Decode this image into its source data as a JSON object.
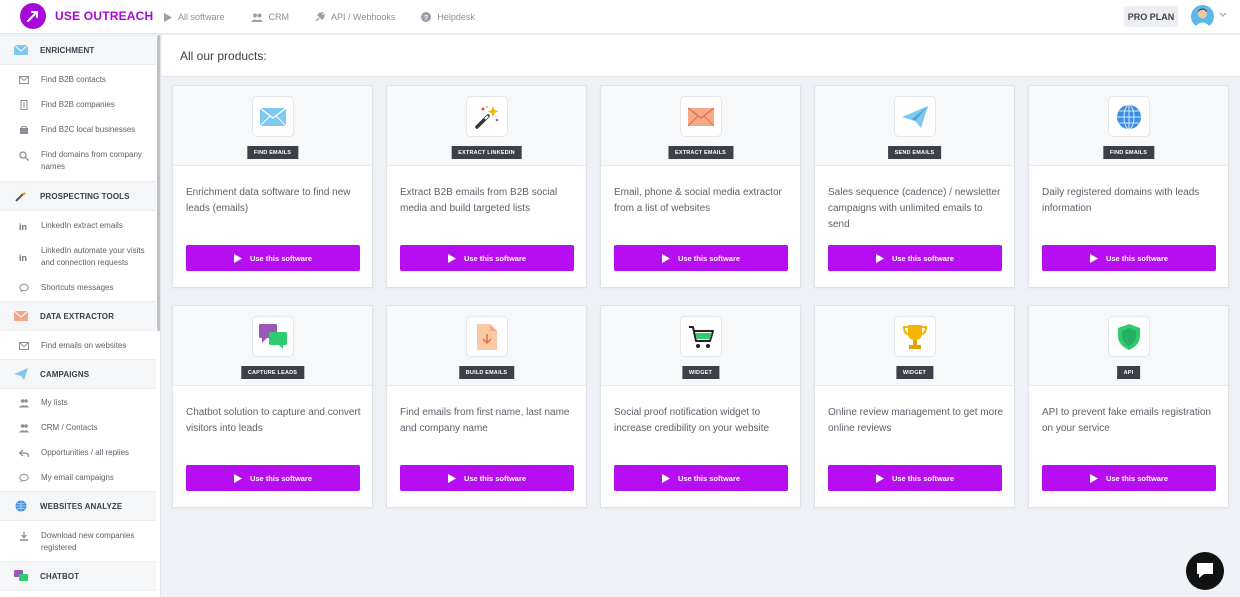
{
  "brand": {
    "name": "USE OUTREACH",
    "color": "#a707d8"
  },
  "nav": [
    {
      "label": "All software",
      "icon": "play-icon"
    },
    {
      "label": "CRM",
      "icon": "users-icon"
    },
    {
      "label": "API / Webhooks",
      "icon": "plug-icon"
    },
    {
      "label": "Helpdesk",
      "icon": "help-icon"
    }
  ],
  "plan": "PRO PLAN",
  "sidebar": {
    "sections": [
      {
        "label": "ENRICHMENT",
        "icon": "envelope-icon",
        "items": [
          {
            "label": "Find B2B contacts",
            "icon": "envelope-icon"
          },
          {
            "label": "Find B2B companies",
            "icon": "building-icon"
          },
          {
            "label": "Find B2C local businesses",
            "icon": "shop-icon"
          },
          {
            "label": "Find domains from company names",
            "icon": "search-icon"
          }
        ]
      },
      {
        "label": "PROSPECTING TOOLS",
        "icon": "magic-wand-icon",
        "items": [
          {
            "label": "LinkedIn extract emails",
            "icon": "linkedin-icon"
          },
          {
            "label": "LinkedIn automate your visits and connection requests",
            "icon": "linkedin-icon"
          },
          {
            "label": "Shortcuts messages",
            "icon": "chat-icon"
          }
        ]
      },
      {
        "label": "DATA EXTRACTOR",
        "icon": "envelope-orange-icon",
        "items": [
          {
            "label": "Find emails on websites",
            "icon": "envelope-icon"
          }
        ]
      },
      {
        "label": "CAMPAIGNS",
        "icon": "paper-plane-icon",
        "items": [
          {
            "label": "My lists",
            "icon": "users-icon"
          },
          {
            "label": "CRM / Contacts",
            "icon": "users-icon"
          },
          {
            "label": "Opportunities / all replies",
            "icon": "reply-icon"
          },
          {
            "label": "My email campaigns",
            "icon": "chat-icon"
          }
        ]
      },
      {
        "label": "WEBSITES ANALYZE",
        "icon": "globe-icon",
        "items": [
          {
            "label": "Download new companies registered",
            "icon": "download-icon"
          }
        ]
      },
      {
        "label": "CHATBOT",
        "icon": "chat-bubbles-icon",
        "items": []
      }
    ]
  },
  "main": {
    "title": "All our products:"
  },
  "products": [
    {
      "tag": "FIND EMAILS",
      "icon": "envelope-icon",
      "desc": "Enrichment data software to find new leads (emails)",
      "button": "Use this software"
    },
    {
      "tag": "EXTRACT LINKEDIN",
      "icon": "magic-wand-icon",
      "desc": "Extract B2B emails from B2B social media and build targeted lists",
      "button": "Use this software"
    },
    {
      "tag": "EXTRACT EMAILS",
      "icon": "envelope-orange-icon",
      "desc": "Email, phone & social media extractor from a list of websites",
      "button": "Use this software"
    },
    {
      "tag": "SEND EMAILS",
      "icon": "paper-plane-icon",
      "desc": "Sales sequence (cadence) / newsletter campaigns with unlimited emails to send",
      "button": "Use this software"
    },
    {
      "tag": "FIND EMAILS",
      "icon": "globe-icon",
      "desc": "Daily registered domains with leads information",
      "button": "Use this software"
    },
    {
      "tag": "CAPTURE LEADS",
      "icon": "chat-bubbles-icon",
      "desc": "Chatbot solution to capture and convert visitors into leads",
      "button": "Use this software"
    },
    {
      "tag": "BUILD EMAILS",
      "icon": "download-file-icon",
      "desc": "Find emails from first name, last name and company name",
      "button": "Use this software"
    },
    {
      "tag": "WIDGET",
      "icon": "cart-icon",
      "desc": "Social proof notification widget to increase credibility on your website",
      "button": "Use this software"
    },
    {
      "tag": "WIDGET",
      "icon": "trophy-icon",
      "desc": "Online review management to get more online reviews",
      "button": "Use this software"
    },
    {
      "tag": "API",
      "icon": "shield-icon",
      "desc": "API to prevent fake emails registration on your service",
      "button": "Use this software"
    }
  ],
  "colors": {
    "accent": "#b60ef0",
    "tag": "#3c4048"
  }
}
